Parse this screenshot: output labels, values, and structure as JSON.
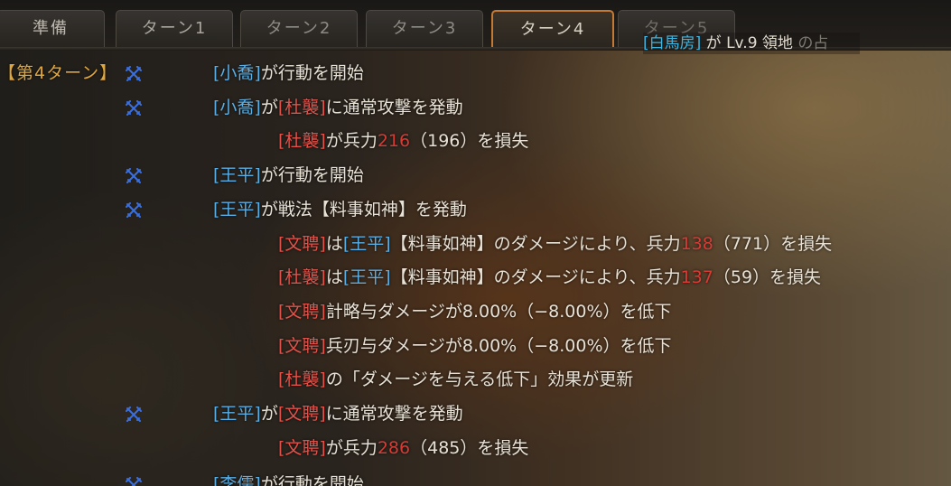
{
  "tabs": [
    "準備",
    "ターン1",
    "ターン2",
    "ターン3",
    "ターン4",
    "ターン5"
  ],
  "notice": {
    "name": "[白馬房]",
    "text": " が Lv.9 領地 ",
    "fade": "の占"
  },
  "turn_label": "【第4ターン】",
  "log": [
    {
      "icon": true,
      "indent": "actor",
      "parts": [
        [
          "blu",
          "[小喬]"
        ],
        [
          "",
          "が行動を開始"
        ]
      ]
    },
    {
      "icon": true,
      "indent": "actor",
      "parts": [
        [
          "blu",
          "[小喬]"
        ],
        [
          "",
          "が"
        ],
        [
          "red",
          "[杜襲]"
        ],
        [
          "",
          "に通常攻撃を発動"
        ]
      ]
    },
    {
      "icon": false,
      "indent": "effect",
      "parts": [
        [
          "red",
          "[杜襲]"
        ],
        [
          "",
          "が兵力"
        ],
        [
          "num",
          "216"
        ],
        [
          "",
          "（196）を損失"
        ]
      ]
    },
    {
      "icon": true,
      "indent": "actor",
      "parts": [
        [
          "blu",
          "[王平]"
        ],
        [
          "",
          "が行動を開始"
        ]
      ]
    },
    {
      "icon": true,
      "indent": "actor",
      "parts": [
        [
          "blu",
          "[王平]"
        ],
        [
          "",
          "が戦法【料事如神】を発動"
        ]
      ]
    },
    {
      "icon": false,
      "indent": "effect",
      "parts": [
        [
          "red",
          "[文聘]"
        ],
        [
          "",
          "は"
        ],
        [
          "blu",
          "[王平]"
        ],
        [
          "",
          "【料事如神】のダメージにより、兵力"
        ],
        [
          "num",
          "138"
        ],
        [
          "",
          "（771）を損失"
        ]
      ]
    },
    {
      "icon": false,
      "indent": "effect",
      "parts": [
        [
          "red",
          "[杜襲]"
        ],
        [
          "",
          "は"
        ],
        [
          "blu",
          "[王平]"
        ],
        [
          "",
          "【料事如神】のダメージにより、兵力"
        ],
        [
          "num",
          "137"
        ],
        [
          "",
          "（59）を損失"
        ]
      ]
    },
    {
      "icon": false,
      "indent": "effect",
      "parts": [
        [
          "red",
          "[文聘]"
        ],
        [
          "",
          "計略与ダメージが8.00%（−8.00%）を低下"
        ]
      ]
    },
    {
      "icon": false,
      "indent": "effect",
      "parts": [
        [
          "red",
          "[文聘]"
        ],
        [
          "",
          "兵刃与ダメージが8.00%（−8.00%）を低下"
        ]
      ]
    },
    {
      "icon": false,
      "indent": "effect",
      "parts": [
        [
          "red",
          "[杜襲]"
        ],
        [
          "",
          "の「ダメージを与える低下」効果が更新"
        ]
      ]
    },
    {
      "icon": true,
      "indent": "actor",
      "parts": [
        [
          "blu",
          "[王平]"
        ],
        [
          "",
          "が"
        ],
        [
          "red",
          "[文聘]"
        ],
        [
          "",
          "に通常攻撃を発動"
        ]
      ]
    },
    {
      "icon": false,
      "indent": "effect",
      "parts": [
        [
          "red",
          "[文聘]"
        ],
        [
          "",
          "が兵力"
        ],
        [
          "num",
          "286"
        ],
        [
          "",
          "（485）を損失"
        ]
      ]
    },
    {
      "icon": true,
      "indent": "actor",
      "parts": [
        [
          "blu",
          "[李儒]"
        ],
        [
          "",
          "が行動を開始"
        ]
      ]
    }
  ],
  "colors": {
    "ally": "#59aee6",
    "enemy": "#e2524a",
    "loss": "#d83a34",
    "turn": "#e0a63a",
    "active_tab": "#c47a35"
  },
  "icon_name": "crossed-swords-icon"
}
